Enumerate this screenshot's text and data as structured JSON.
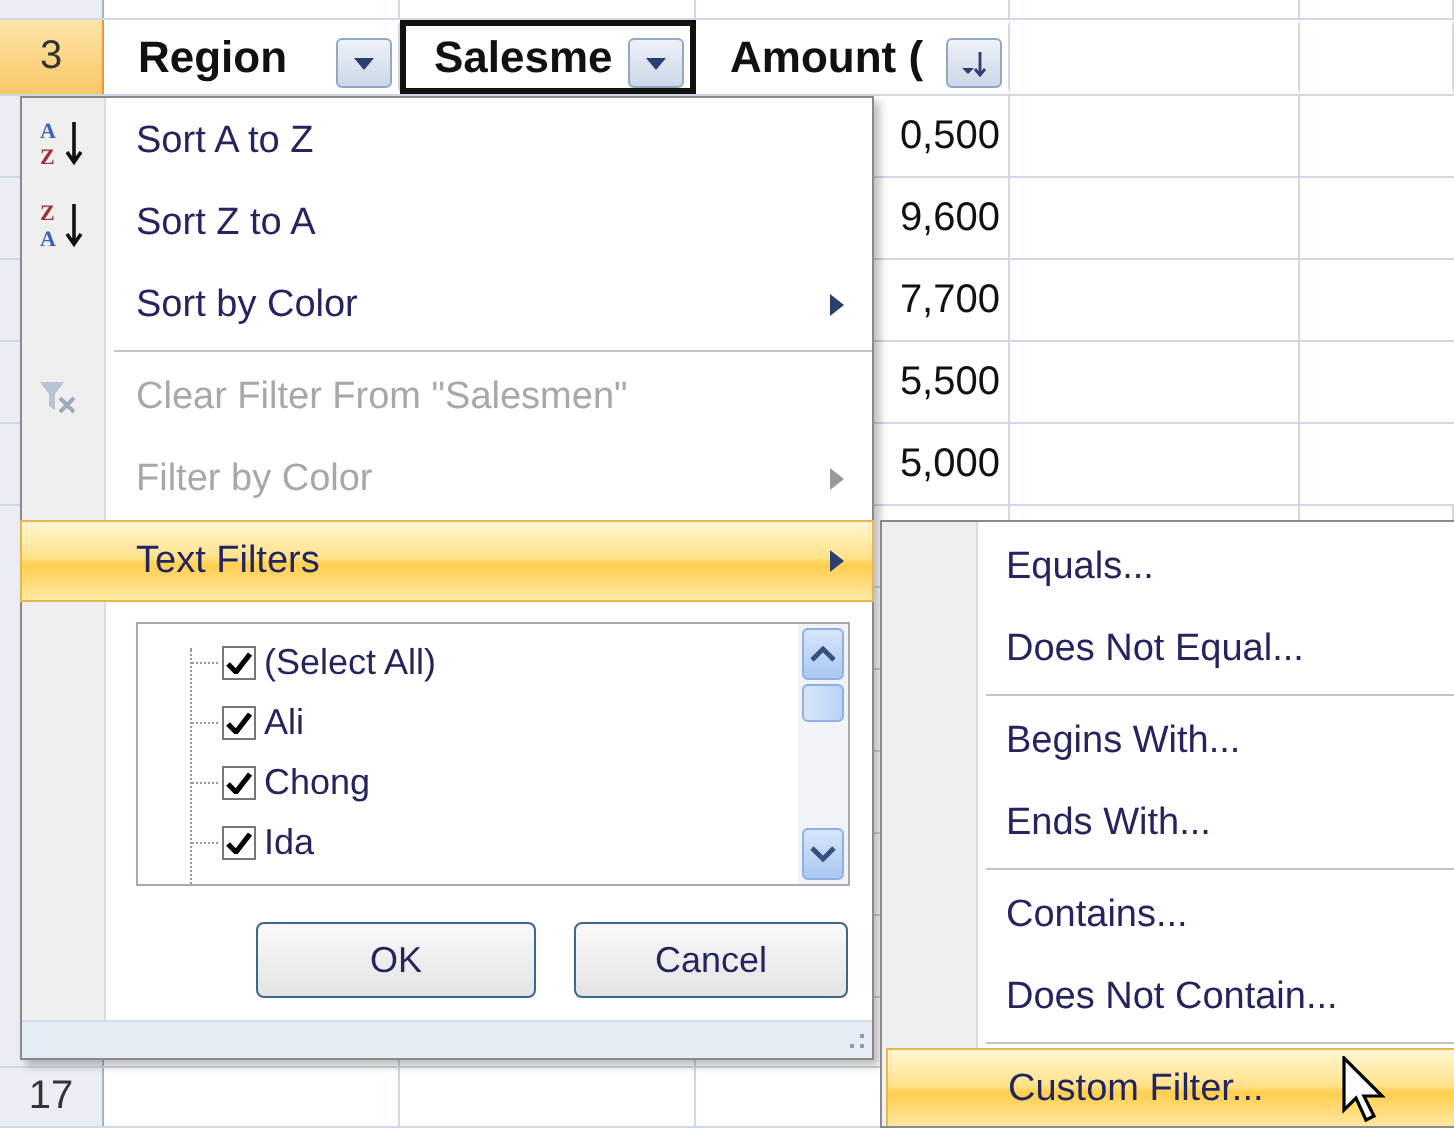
{
  "row_headers": [
    {
      "label": "3",
      "selected": true
    },
    {
      "label": "17",
      "selected": false
    }
  ],
  "header_cells": [
    {
      "text": "Region",
      "selected": false
    },
    {
      "text": "Salesme",
      "selected": true
    },
    {
      "text": "Amount (",
      "selected": false
    }
  ],
  "amounts": [
    "0,500",
    "9,600",
    "7,700",
    "5,500",
    "5,000"
  ],
  "filter_menu": {
    "items": [
      {
        "kind": "item",
        "label": "Sort A to Z",
        "icon_letters": [
          "A",
          "Z"
        ],
        "disabled": false,
        "submenu": false,
        "selected": false
      },
      {
        "kind": "item",
        "label": "Sort Z to A",
        "icon_letters": [
          "Z",
          "A"
        ],
        "disabled": false,
        "submenu": false,
        "selected": false
      },
      {
        "kind": "item",
        "label": "Sort by Color",
        "disabled": false,
        "submenu": true,
        "selected": false
      },
      {
        "kind": "separator"
      },
      {
        "kind": "item",
        "label": "Clear Filter From \"Salesmen\"",
        "disabled": true,
        "submenu": false,
        "selected": false
      },
      {
        "kind": "item",
        "label": "Filter by Color",
        "disabled": true,
        "submenu": true,
        "selected": false
      },
      {
        "kind": "item",
        "label": "Text Filters",
        "disabled": false,
        "submenu": true,
        "selected": true
      }
    ],
    "values": [
      {
        "label": "(Select All)",
        "checked": true
      },
      {
        "label": "Ali",
        "checked": true
      },
      {
        "label": "Chong",
        "checked": true
      },
      {
        "label": "Ida",
        "checked": true
      }
    ],
    "buttons": [
      "OK",
      "Cancel"
    ]
  },
  "text_filters_menu": {
    "items": [
      {
        "kind": "item",
        "label": "Equals...",
        "selected": false
      },
      {
        "kind": "item",
        "label": "Does Not Equal...",
        "selected": false
      },
      {
        "kind": "separator"
      },
      {
        "kind": "item",
        "label": "Begins With...",
        "selected": false
      },
      {
        "kind": "item",
        "label": "Ends With...",
        "selected": false
      },
      {
        "kind": "separator"
      },
      {
        "kind": "item",
        "label": "Contains...",
        "selected": false
      },
      {
        "kind": "item",
        "label": "Does Not Contain...",
        "selected": false
      },
      {
        "kind": "separator"
      },
      {
        "kind": "item",
        "label": "Custom Filter...",
        "selected": true
      }
    ]
  }
}
